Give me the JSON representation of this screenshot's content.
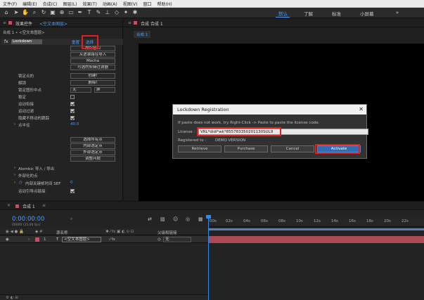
{
  "menu": [
    "文件(F)",
    "编辑(E)",
    "合成(C)",
    "图层(L)",
    "效果(T)",
    "动画(A)",
    "视图(V)",
    "窗口",
    "帮助(H)"
  ],
  "toolbar": {
    "icons": [
      "home-icon",
      "selection-tool-icon",
      "hand-tool-icon",
      "zoom-tool-icon",
      "rotate-tool-icon",
      "camera-tool-icon",
      "pan-behind-icon",
      "rectangle-tool-icon",
      "pen-tool-icon",
      "type-tool-icon",
      "brush-tool-icon",
      "clone-stamp-icon",
      "eraser-icon",
      "roto-brush-icon",
      "puppet-tool-icon"
    ],
    "workspaces": [
      "默认",
      "了解",
      "标准",
      "小屏幕"
    ],
    "active_workspace": "默认",
    "accent": "#4f9cf5"
  },
  "effect_panel": {
    "tab_label": "效果控件",
    "tab_layer": "<空文本图层>",
    "breadcrumb": "合成 1 • <空文本图层>",
    "effect_name": "Lockdown",
    "reset_label": "重置",
    "about_label": "选择",
    "buttons_top": [
      "跟踪窗口",
      "从遮罩路径导入",
      "Mocha",
      "可选的剪辑过滤器"
    ],
    "rows": [
      {
        "label": "锁定点的",
        "button": "创建!"
      },
      {
        "label": "解锁",
        "button": "删除!"
      },
      {
        "label": "锁定图形中点",
        "value": "无",
        "value2": "屏"
      },
      {
        "label": "稳定",
        "checked": false
      },
      {
        "label": "运动衔接",
        "checked": true
      },
      {
        "label": "运动过滤",
        "checked": true
      },
      {
        "label": "隐藏不移动的跟踪",
        "checked": true
      },
      {
        "label": "点半径",
        "value": "40.0"
      }
    ],
    "buttons_bottom": [
      "选择所有点",
      "内部选定点",
      "外部选定点",
      "调整问题"
    ],
    "groups": [
      "Alembic 导入 / 导出",
      "外部化的点",
      "内部关键帧时间 SEF",
      "运动引导点链接"
    ],
    "sef_value": "0"
  },
  "comp_panel": {
    "tab_label": "合成 合成 1",
    "sub_tab": "合成 1"
  },
  "dialog": {
    "title": "Lockdown Registration",
    "instruction": "If paste does not work, try Right-Click -> Paste to paste the license code.",
    "license_label": "License :",
    "license_value": "VRL*didi*wk*855783350201130SUL9",
    "registered_label": "Registered to :",
    "registered_value": "DEMO VERSION",
    "buttons": [
      "Retrieve",
      "Purchase",
      "Cancel",
      "Activate"
    ]
  },
  "timeline": {
    "tab_label": "合成 1",
    "time": "0:00:00:00",
    "frames": "00000 (25.00 fps)",
    "columns": {
      "source": "源名称",
      "parent": "父级和链接"
    },
    "layer": {
      "index": "1",
      "type": "T",
      "name": "<空文本图层>",
      "parent": "无",
      "color": "#c6505e"
    },
    "ruler": [
      "00s",
      "02s",
      "04s",
      "06s",
      "08s",
      "10s",
      "12s",
      "14s",
      "16s",
      "18s",
      "20s",
      "22s"
    ]
  }
}
